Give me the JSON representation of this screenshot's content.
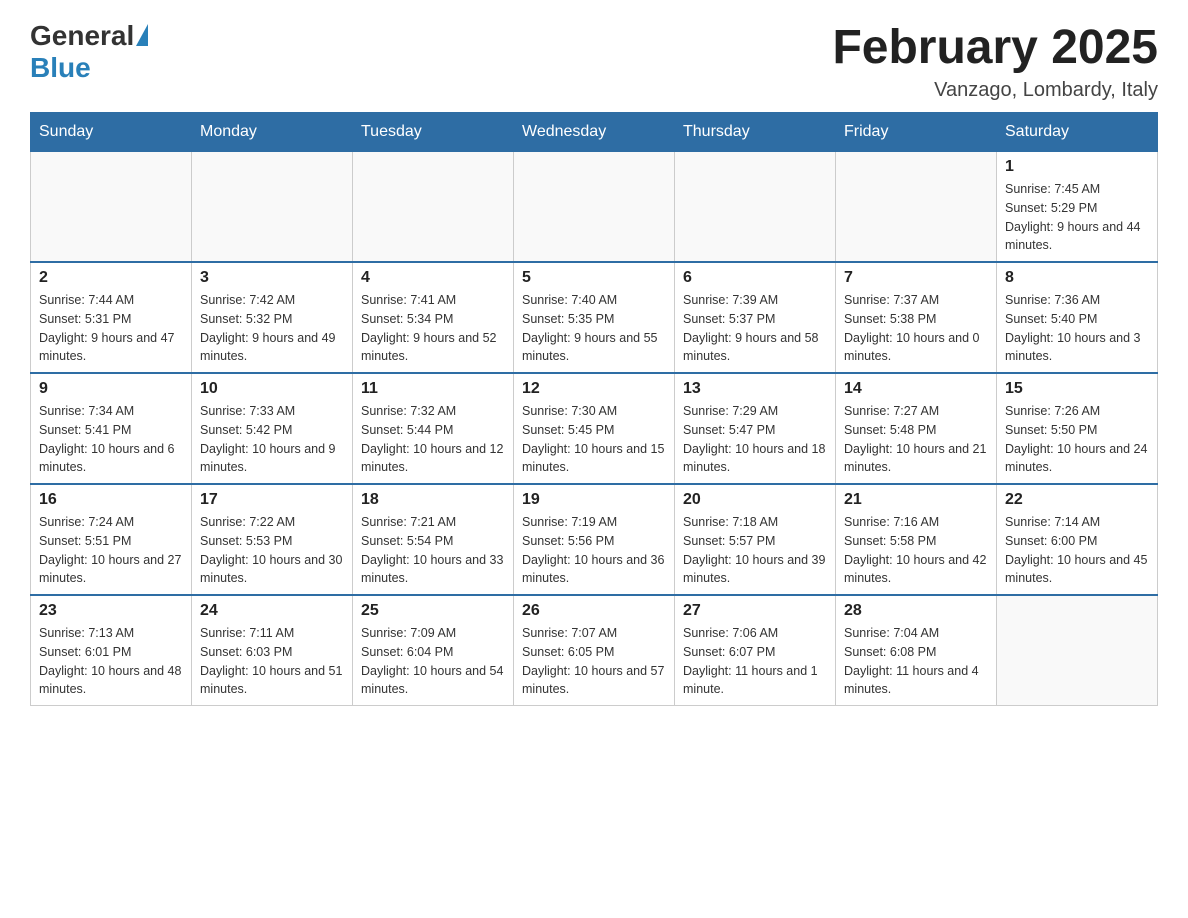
{
  "header": {
    "logo_general": "General",
    "logo_blue": "Blue",
    "title": "February 2025",
    "subtitle": "Vanzago, Lombardy, Italy"
  },
  "days_of_week": [
    "Sunday",
    "Monday",
    "Tuesday",
    "Wednesday",
    "Thursday",
    "Friday",
    "Saturday"
  ],
  "weeks": [
    {
      "days": [
        {
          "number": "",
          "info": ""
        },
        {
          "number": "",
          "info": ""
        },
        {
          "number": "",
          "info": ""
        },
        {
          "number": "",
          "info": ""
        },
        {
          "number": "",
          "info": ""
        },
        {
          "number": "",
          "info": ""
        },
        {
          "number": "1",
          "info": "Sunrise: 7:45 AM\nSunset: 5:29 PM\nDaylight: 9 hours and 44 minutes."
        }
      ]
    },
    {
      "days": [
        {
          "number": "2",
          "info": "Sunrise: 7:44 AM\nSunset: 5:31 PM\nDaylight: 9 hours and 47 minutes."
        },
        {
          "number": "3",
          "info": "Sunrise: 7:42 AM\nSunset: 5:32 PM\nDaylight: 9 hours and 49 minutes."
        },
        {
          "number": "4",
          "info": "Sunrise: 7:41 AM\nSunset: 5:34 PM\nDaylight: 9 hours and 52 minutes."
        },
        {
          "number": "5",
          "info": "Sunrise: 7:40 AM\nSunset: 5:35 PM\nDaylight: 9 hours and 55 minutes."
        },
        {
          "number": "6",
          "info": "Sunrise: 7:39 AM\nSunset: 5:37 PM\nDaylight: 9 hours and 58 minutes."
        },
        {
          "number": "7",
          "info": "Sunrise: 7:37 AM\nSunset: 5:38 PM\nDaylight: 10 hours and 0 minutes."
        },
        {
          "number": "8",
          "info": "Sunrise: 7:36 AM\nSunset: 5:40 PM\nDaylight: 10 hours and 3 minutes."
        }
      ]
    },
    {
      "days": [
        {
          "number": "9",
          "info": "Sunrise: 7:34 AM\nSunset: 5:41 PM\nDaylight: 10 hours and 6 minutes."
        },
        {
          "number": "10",
          "info": "Sunrise: 7:33 AM\nSunset: 5:42 PM\nDaylight: 10 hours and 9 minutes."
        },
        {
          "number": "11",
          "info": "Sunrise: 7:32 AM\nSunset: 5:44 PM\nDaylight: 10 hours and 12 minutes."
        },
        {
          "number": "12",
          "info": "Sunrise: 7:30 AM\nSunset: 5:45 PM\nDaylight: 10 hours and 15 minutes."
        },
        {
          "number": "13",
          "info": "Sunrise: 7:29 AM\nSunset: 5:47 PM\nDaylight: 10 hours and 18 minutes."
        },
        {
          "number": "14",
          "info": "Sunrise: 7:27 AM\nSunset: 5:48 PM\nDaylight: 10 hours and 21 minutes."
        },
        {
          "number": "15",
          "info": "Sunrise: 7:26 AM\nSunset: 5:50 PM\nDaylight: 10 hours and 24 minutes."
        }
      ]
    },
    {
      "days": [
        {
          "number": "16",
          "info": "Sunrise: 7:24 AM\nSunset: 5:51 PM\nDaylight: 10 hours and 27 minutes."
        },
        {
          "number": "17",
          "info": "Sunrise: 7:22 AM\nSunset: 5:53 PM\nDaylight: 10 hours and 30 minutes."
        },
        {
          "number": "18",
          "info": "Sunrise: 7:21 AM\nSunset: 5:54 PM\nDaylight: 10 hours and 33 minutes."
        },
        {
          "number": "19",
          "info": "Sunrise: 7:19 AM\nSunset: 5:56 PM\nDaylight: 10 hours and 36 minutes."
        },
        {
          "number": "20",
          "info": "Sunrise: 7:18 AM\nSunset: 5:57 PM\nDaylight: 10 hours and 39 minutes."
        },
        {
          "number": "21",
          "info": "Sunrise: 7:16 AM\nSunset: 5:58 PM\nDaylight: 10 hours and 42 minutes."
        },
        {
          "number": "22",
          "info": "Sunrise: 7:14 AM\nSunset: 6:00 PM\nDaylight: 10 hours and 45 minutes."
        }
      ]
    },
    {
      "days": [
        {
          "number": "23",
          "info": "Sunrise: 7:13 AM\nSunset: 6:01 PM\nDaylight: 10 hours and 48 minutes."
        },
        {
          "number": "24",
          "info": "Sunrise: 7:11 AM\nSunset: 6:03 PM\nDaylight: 10 hours and 51 minutes."
        },
        {
          "number": "25",
          "info": "Sunrise: 7:09 AM\nSunset: 6:04 PM\nDaylight: 10 hours and 54 minutes."
        },
        {
          "number": "26",
          "info": "Sunrise: 7:07 AM\nSunset: 6:05 PM\nDaylight: 10 hours and 57 minutes."
        },
        {
          "number": "27",
          "info": "Sunrise: 7:06 AM\nSunset: 6:07 PM\nDaylight: 11 hours and 1 minute."
        },
        {
          "number": "28",
          "info": "Sunrise: 7:04 AM\nSunset: 6:08 PM\nDaylight: 11 hours and 4 minutes."
        },
        {
          "number": "",
          "info": ""
        }
      ]
    }
  ]
}
